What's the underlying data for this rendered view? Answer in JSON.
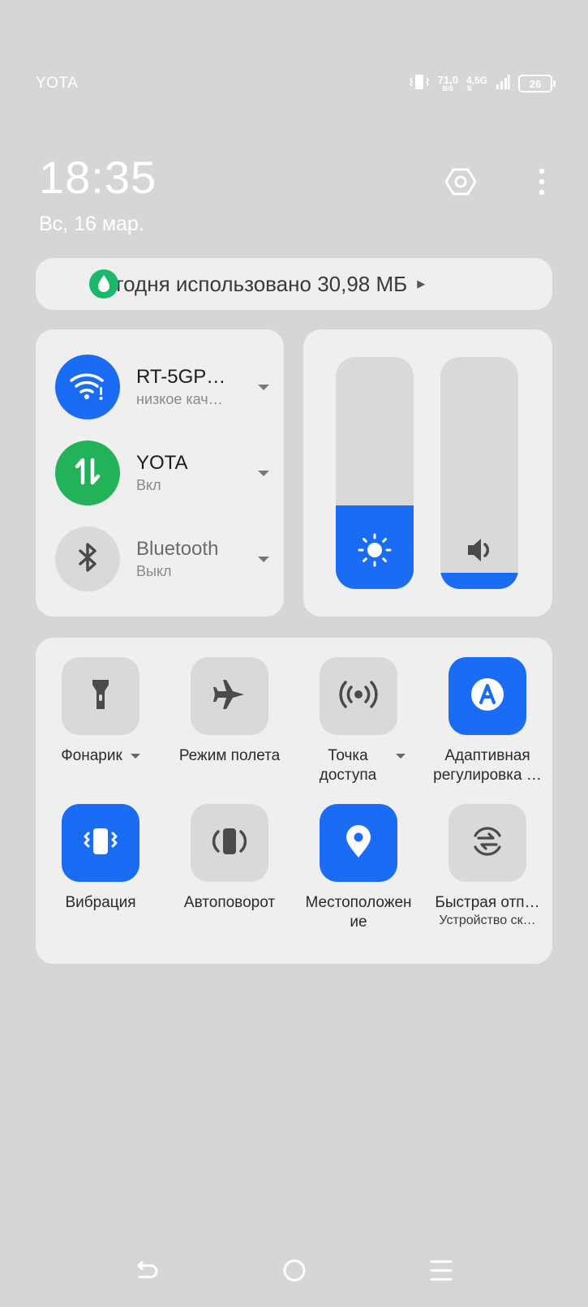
{
  "status_bar": {
    "carrier": "YOTA",
    "speed_value": "71,0",
    "speed_unit": "B/S",
    "network": "4,5G",
    "network_arrows": "⇅",
    "battery": "26"
  },
  "header": {
    "time": "18:35",
    "date": "Вс, 16 мар."
  },
  "data_usage": {
    "text": "Сегодня использовано 30,98 МБ"
  },
  "connections": [
    {
      "title": "RT-5GPO…",
      "subtitle": "низкое кач…",
      "state": "on"
    },
    {
      "title": "YOTA",
      "subtitle": "Вкл",
      "state": "on"
    },
    {
      "title": "Bluetooth",
      "subtitle": "Выкл",
      "state": "off"
    }
  ],
  "sliders": {
    "brightness_level": 0.36,
    "volume_level": 0.07
  },
  "tiles": [
    {
      "label": "Фонарик",
      "active": false,
      "has_menu": true
    },
    {
      "label": "Режим полета",
      "active": false,
      "has_menu": false
    },
    {
      "label": "Точка доступа",
      "active": false,
      "has_menu": true
    },
    {
      "label": "Адаптивная регулировка …",
      "active": true,
      "has_menu": false
    },
    {
      "label": "Вибрация",
      "active": true,
      "has_menu": false
    },
    {
      "label": "Автоповорот",
      "active": false,
      "has_menu": false
    },
    {
      "label": "Местоположение",
      "active": true,
      "has_menu": false
    },
    {
      "label": "Быстрая отп…",
      "sublabel": "Устройство ск…",
      "active": false,
      "has_menu": false
    }
  ],
  "colors": {
    "accent": "#1a6cf5",
    "mobile_data": "#22b25a",
    "usage_drop": "#19b86a"
  },
  "icons": [
    "vibrate-icon",
    "signal-icon",
    "battery-icon",
    "settings-icon",
    "more-icon",
    "water-drop-icon",
    "wifi-warning-icon",
    "mobile-data-icon",
    "bluetooth-icon",
    "brightness-icon",
    "volume-icon",
    "flashlight-icon",
    "airplane-icon",
    "hotspot-icon",
    "auto-brightness-icon",
    "vibration-icon",
    "auto-rotate-icon",
    "location-icon",
    "quick-share-icon",
    "back-icon",
    "home-icon",
    "recents-icon"
  ]
}
